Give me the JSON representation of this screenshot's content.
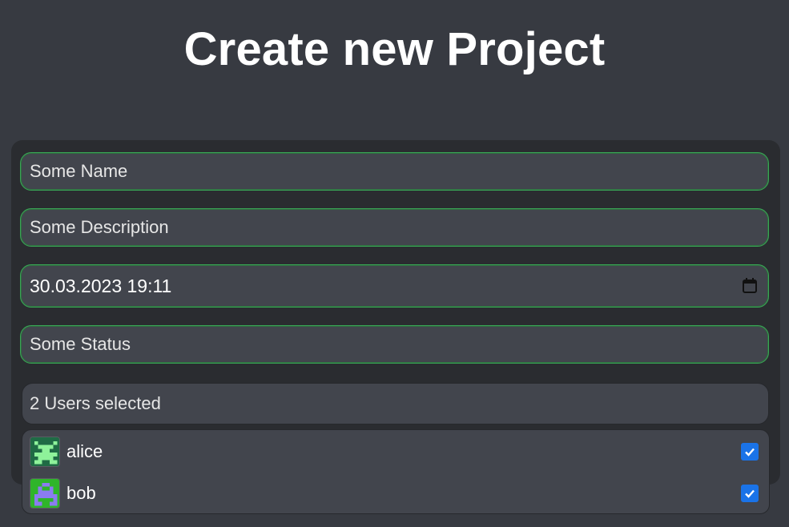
{
  "page": {
    "title": "Create new Project"
  },
  "form": {
    "name_value": "Some Name",
    "description_value": "Some Description",
    "datetime_value": "30.03.2023 19:11",
    "status_value": "Some Status",
    "users_summary": "2 Users selected",
    "users": [
      {
        "name": "alice",
        "checked": true,
        "avatar_icon": "alice-avatar-icon"
      },
      {
        "name": "bob",
        "checked": true,
        "avatar_icon": "bob-avatar-icon"
      }
    ]
  },
  "colors": {
    "background": "#373a41",
    "card": "#2a2c30",
    "field": "#42454d",
    "field_border_focus": "#3aa656",
    "checkbox_accent": "#1a73e8"
  },
  "icons": {
    "calendar": "calendar-icon",
    "checkmark": "checkmark-icon"
  }
}
